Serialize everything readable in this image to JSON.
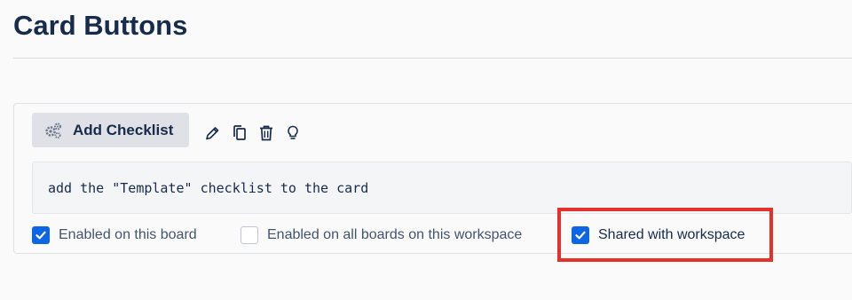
{
  "page": {
    "title": "Card Buttons"
  },
  "card": {
    "button_label": "Add Checklist",
    "command_text": "add the \"Template\" checklist to the card",
    "tools": [
      "pencil-icon",
      "copy-icon",
      "trash-icon",
      "lightbulb-icon"
    ],
    "options": [
      {
        "label": "Enabled on this board",
        "checked": true
      },
      {
        "label": "Enabled on all boards on this workspace",
        "checked": false
      },
      {
        "label": "Shared with workspace",
        "checked": true
      }
    ]
  },
  "colors": {
    "checkbox_checked": "#0c66e4",
    "highlight": "#e5312a",
    "title": "#172b4d"
  }
}
